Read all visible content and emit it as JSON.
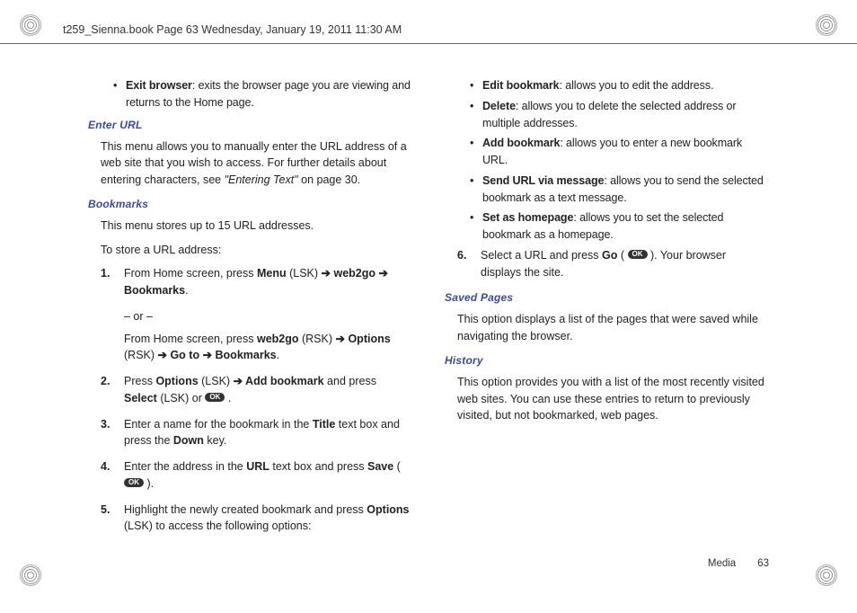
{
  "header": {
    "text": "t259_Sienna.book  Page 63  Wednesday, January 19, 2011  11:30 AM"
  },
  "left": {
    "exit_browser_label": "Exit browser",
    "exit_browser_desc": ": exits the browser page you are viewing and returns to the Home page.",
    "enter_url_heading": "Enter URL",
    "enter_url_body_a": "This menu allows you to manually enter the URL address of a web site that you wish to access. For further details about entering characters, see ",
    "enter_url_body_italic": "\"Entering Text\"",
    "enter_url_body_b": " on page 30.",
    "bookmarks_heading": "Bookmarks",
    "bookmarks_body1": "This menu stores up to 15 URL addresses.",
    "bookmarks_body2": "To store a URL address:",
    "step1_num": "1.",
    "step1_a": "From Home screen, press ",
    "step1_menu": "Menu",
    "step1_b": " (LSK) ",
    "step1_arrow1": "➔",
    "step1_web2go": " web2go ",
    "step1_arrow2": "➔",
    "step1_bookmarks": " Bookmarks",
    "step1_period": ".",
    "or_text": "– or –",
    "step1_alt_a": "From Home screen, press ",
    "step1_alt_web2go": "web2go",
    "step1_alt_b": " (RSK) ",
    "step1_alt_arrow1": "➔",
    "step1_alt_options": " Options",
    "step1_alt_c": " (RSK) ",
    "step1_alt_arrow2": "➔",
    "step1_alt_goto": " Go to ",
    "step1_alt_arrow3": "➔",
    "step1_alt_bookmarks": " Bookmarks",
    "step1_alt_period": ".",
    "step2_num": "2.",
    "step2_a": "Press ",
    "step2_options": "Options",
    "step2_b": " (LSK) ",
    "step2_arrow": "➔",
    "step2_addbm": " Add bookmark",
    "step2_c": " and press ",
    "step2_select": "Select",
    "step2_d": " (LSK) or  ",
    "step2_e": " .",
    "step3_num": "3.",
    "step3_a": "Enter a name for the bookmark in the ",
    "step3_title": "Title",
    "step3_b": " text box and press the ",
    "step3_down": "Down",
    "step3_c": " key.",
    "step4_num": "4.",
    "step4_a": "Enter the address in the ",
    "step4_url": "URL",
    "step4_b": " text box and press ",
    "step4_save": "Save",
    "step4_c": " ( ",
    "step4_d": " )."
  },
  "right": {
    "step5_num": "5.",
    "step5_a": "Highlight the newly created bookmark and press ",
    "step5_options": "Options",
    "step5_b": " (LSK) to access the following options:",
    "opt_edit_label": "Edit bookmark",
    "opt_edit_desc": ": allows you to edit the address.",
    "opt_delete_label": "Delete",
    "opt_delete_desc": ": allows you to delete the selected address or multiple addresses.",
    "opt_add_label": "Add bookmark",
    "opt_add_desc": ": allows you to enter a new bookmark URL.",
    "opt_send_label": "Send URL via message",
    "opt_send_desc": ": allows you to send the selected bookmark as a text message.",
    "opt_home_label": "Set as homepage",
    "opt_home_desc": ": allows you to set the selected bookmark as a homepage.",
    "step6_num": "6.",
    "step6_a": "Select a URL and press ",
    "step6_go": "Go",
    "step6_b": " ( ",
    "step6_c": " ). Your browser displays the site.",
    "saved_pages_heading": "Saved Pages",
    "saved_pages_body": "This option displays a list of the pages that were saved while navigating the browser.",
    "history_heading": "History",
    "history_body": "This option provides you with a list of the most recently visited web sites. You can use these entries to return to previously visited, but not bookmarked, web pages."
  },
  "footer": {
    "section": "Media",
    "page_num": "63"
  },
  "ok_label": "OK"
}
